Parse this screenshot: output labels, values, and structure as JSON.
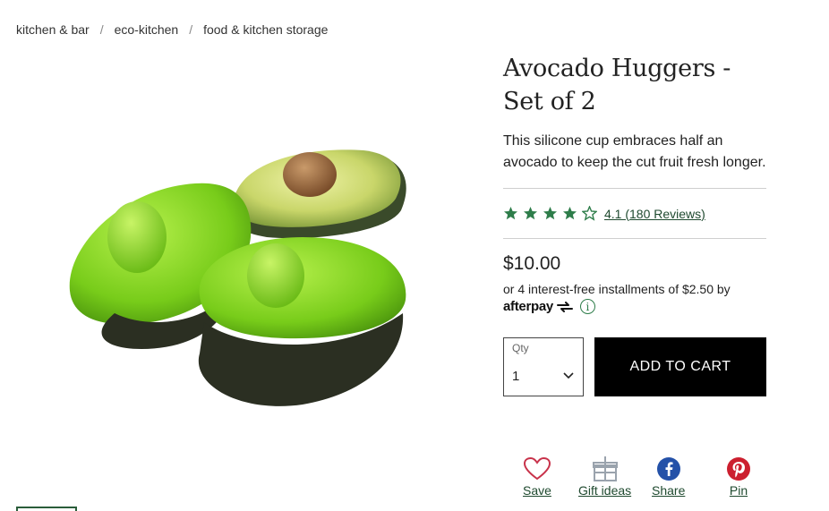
{
  "breadcrumb": {
    "items": [
      "kitchen & bar",
      "eco-kitchen",
      "food & kitchen storage"
    ],
    "separator": "/"
  },
  "product": {
    "title": "Avocado Huggers - Set of 2",
    "description": "This silicone cup embraces half an avocado to keep the cut fruit fresh longer.",
    "rating_text": "4.1 (180 Reviews)",
    "rating_value": 4.1,
    "rating_max": 5,
    "price": "$10.00",
    "installments": "or 4 interest-free installments of $2.50 by",
    "afterpay_logo": "afterpay",
    "info_icon": "i"
  },
  "purchase": {
    "qty_label": "Qty",
    "qty_value": "1",
    "add_to_cart": "ADD TO CART"
  },
  "actions": {
    "save": "Save",
    "gift_ideas": "Gift ideas",
    "share": "Share",
    "pin": "Pin"
  },
  "colors": {
    "star_green": "#2e7d4a",
    "link_green": "#1f4a2f",
    "heart_red": "#c8324a",
    "facebook_blue": "#2451a8",
    "pinterest_red": "#cc1f2f",
    "button_black": "#000000"
  },
  "icons": [
    "star-icon",
    "info-icon",
    "chevron-down-icon",
    "heart-icon",
    "gift-icon",
    "facebook-icon",
    "pinterest-icon"
  ]
}
